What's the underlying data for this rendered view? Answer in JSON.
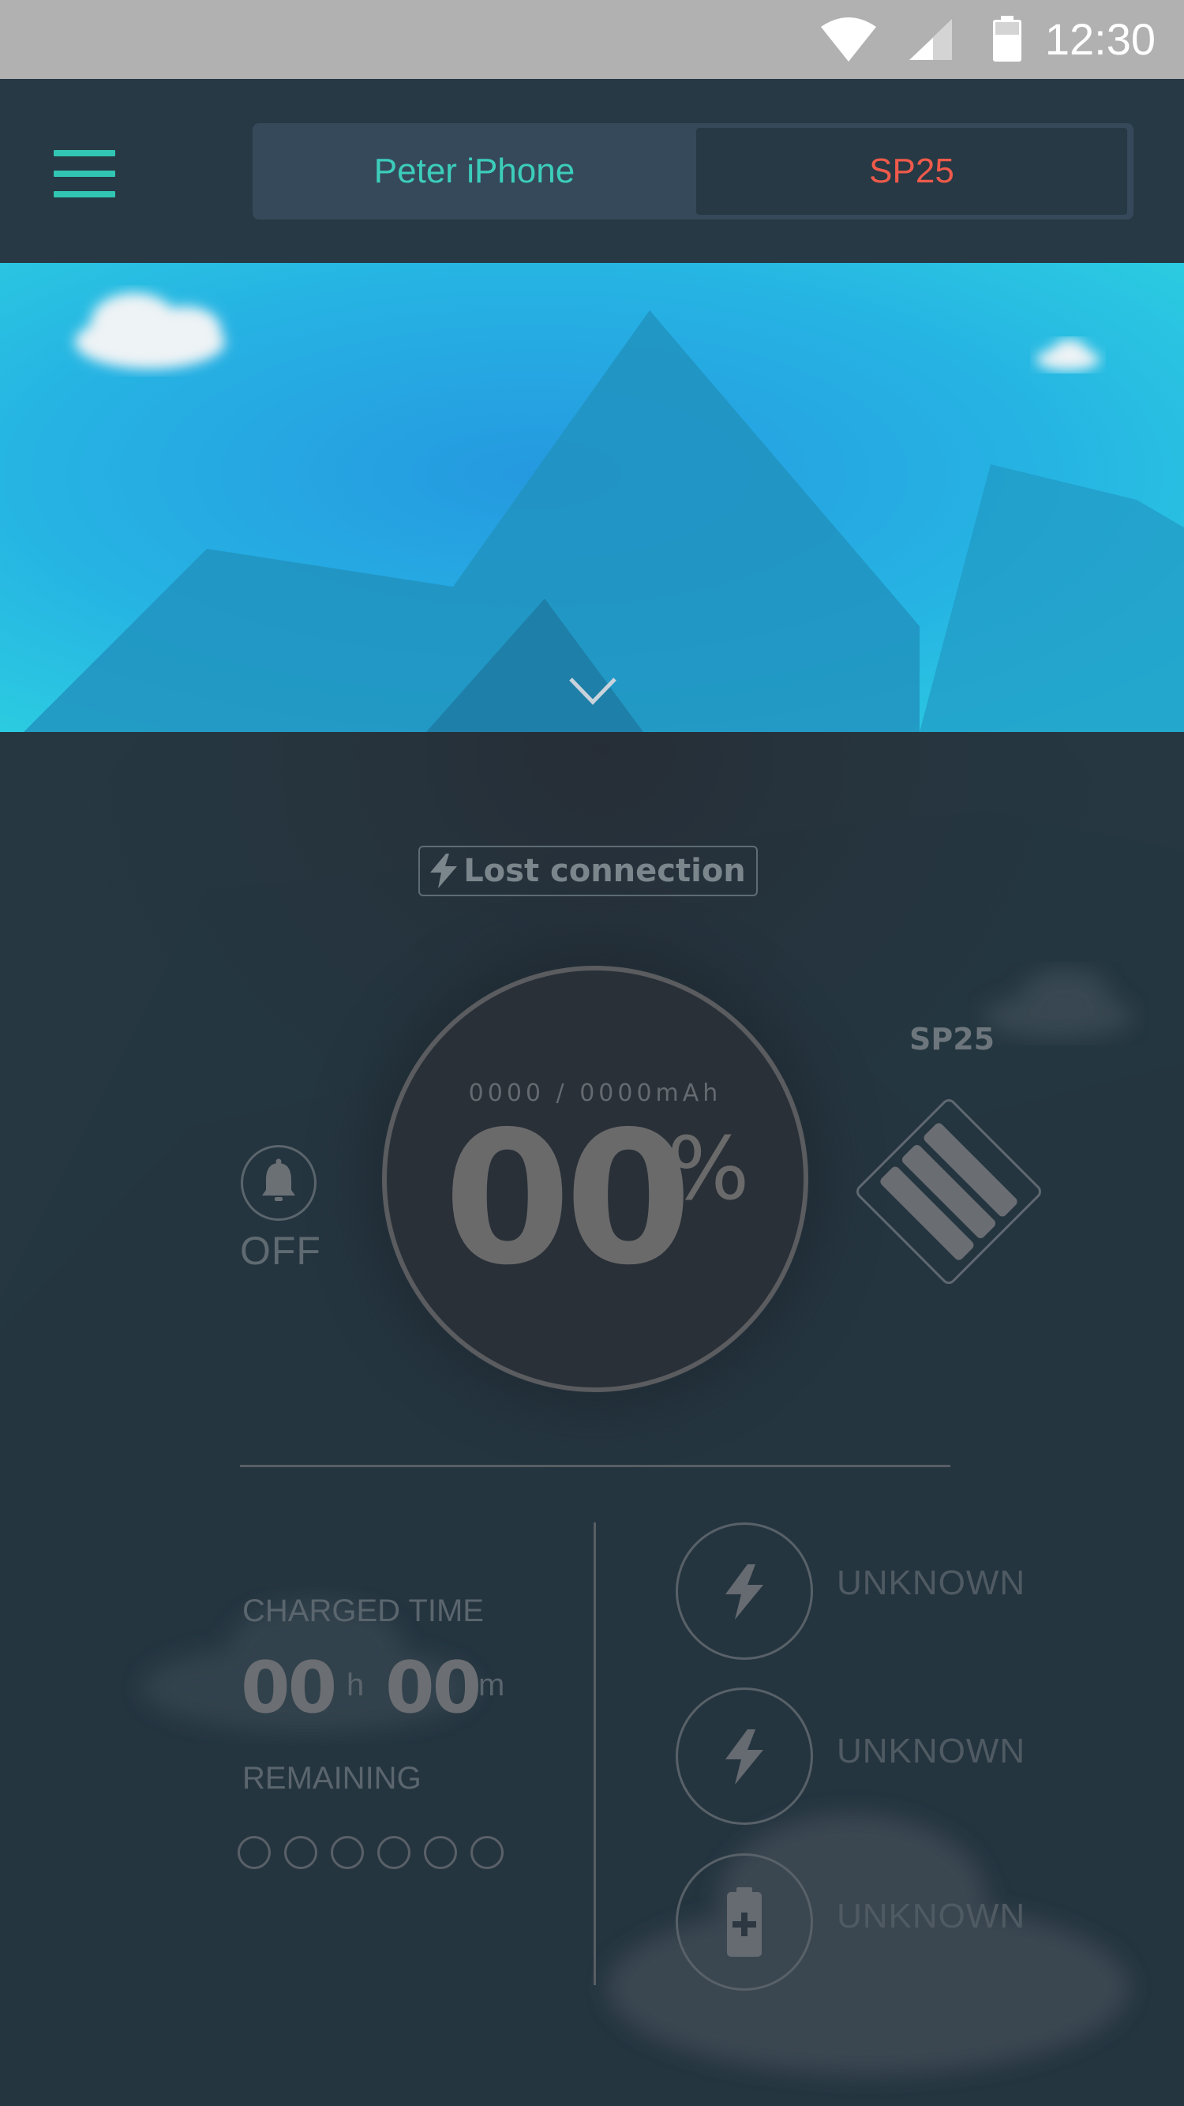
{
  "status_bar": {
    "time": "12:30"
  },
  "header": {
    "tabs": [
      {
        "label": "Peter iPhone",
        "color": "#3ccdbb"
      },
      {
        "label": "SP25",
        "color": "#ef5a4b",
        "selected": true
      }
    ],
    "accent_color": "#31c5b3"
  },
  "connection": {
    "status": "Lost connection"
  },
  "alarm": {
    "state": "OFF"
  },
  "battery": {
    "capacity": "0000 / 0000mAh",
    "percent": "00",
    "percent_sign": "%"
  },
  "device": {
    "name": "SP25"
  },
  "charge": {
    "label": "CHARGED TIME",
    "hours": "00",
    "hours_unit": "h",
    "minutes": "00",
    "minutes_unit": "m",
    "remaining_label": "REMAINING",
    "remaining_dots": 6
  },
  "stats": [
    {
      "icon": "lightning-icon",
      "label": "UNKNOWN"
    },
    {
      "icon": "lightning-icon",
      "label": "UNKNOWN"
    },
    {
      "icon": "battery-plus-icon",
      "label": "UNKNOWN"
    }
  ]
}
